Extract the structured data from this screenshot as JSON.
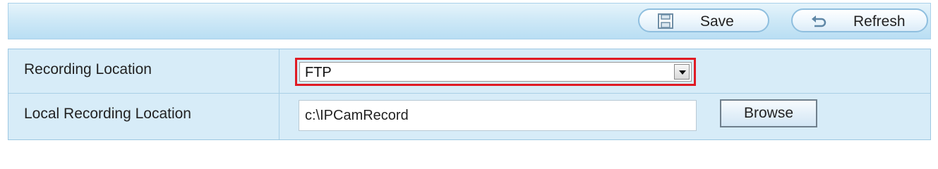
{
  "toolbar": {
    "save_label": "Save",
    "save_icon": "floppy-disk-icon",
    "refresh_label": "Refresh",
    "refresh_icon": "refresh-arrow-icon"
  },
  "form": {
    "recording_location": {
      "label": "Recording Location",
      "selected_value": "FTP",
      "highlight_color": "#e01b24"
    },
    "local_recording_location": {
      "label": "Local Recording Location",
      "value": "c:\\IPCamRecord",
      "browse_label": "Browse"
    }
  }
}
